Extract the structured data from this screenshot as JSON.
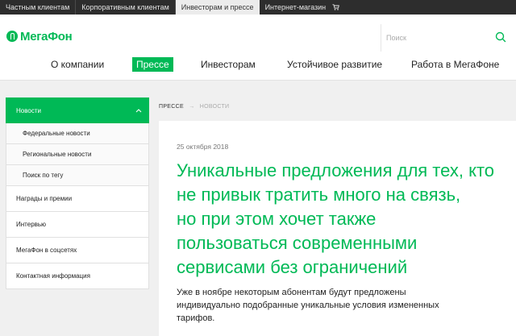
{
  "topbar": {
    "tabs": [
      {
        "label": "Частным клиентам"
      },
      {
        "label": "Корпоративным клиентам"
      },
      {
        "label": "Инвесторам и прессе"
      },
      {
        "label": "Интернет-магазин"
      }
    ]
  },
  "header": {
    "logo_text": "МегаФон",
    "brand_color": "#00b956",
    "search": {
      "placeholder": "Поиск"
    }
  },
  "nav": {
    "items": [
      {
        "label": "О компании"
      },
      {
        "label": "Прессе"
      },
      {
        "label": "Инвесторам"
      },
      {
        "label": "Устойчивое развитие"
      },
      {
        "label": "Работа в МегаФоне"
      }
    ]
  },
  "sidebar": {
    "items": [
      {
        "label": "Новости"
      },
      {
        "label": "Федеральные новости"
      },
      {
        "label": "Региональные новости"
      },
      {
        "label": "Поиск по тегу"
      },
      {
        "label": "Награды и премии"
      },
      {
        "label": "Интервью"
      },
      {
        "label": "МегаФон в соцсетях"
      },
      {
        "label": "Контактная информация"
      }
    ]
  },
  "breadcrumb": {
    "root": "ПРЕССЕ",
    "separator": "→",
    "current": "НОВОСТИ"
  },
  "article": {
    "date": "25 октября 2018",
    "headline_lines": [
      "Уникальные предложения для тех, кто",
      "не привык тратить много на связь,",
      "но при этом хочет также",
      "пользоваться современными",
      "сервисами без ограничений"
    ],
    "lead_lines": [
      "Уже в ноябре некоторым абонентам будут предложены",
      "индивидуально подобранные уникальные условия измененных",
      "тарифов."
    ]
  }
}
